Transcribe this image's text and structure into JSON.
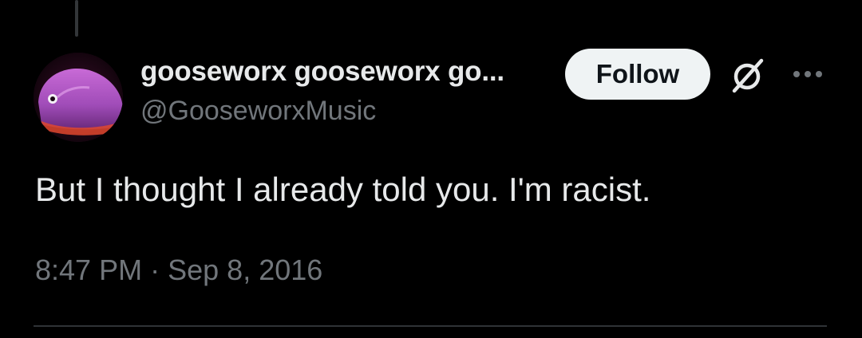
{
  "author": {
    "display_name": "gooseworx gooseworx go...",
    "handle": "@GooseworxMusic",
    "avatar_icon": "pink-creature-avatar"
  },
  "actions": {
    "follow_label": "Follow",
    "grok_icon": "grok-slash-icon",
    "more_icon": "more-dots-icon"
  },
  "tweet": {
    "text": "But I thought I already told you. I'm racist.",
    "time": "8:47 PM",
    "separator": "·",
    "date": "Sep 8, 2016"
  },
  "colors": {
    "background": "#000000",
    "text_primary": "#e7e9ea",
    "text_secondary": "#71767b",
    "follow_bg": "#eff3f4",
    "divider": "#2f3336"
  }
}
